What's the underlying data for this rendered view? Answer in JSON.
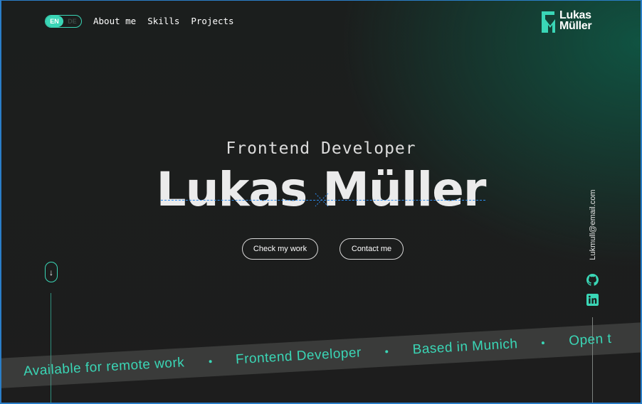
{
  "language_switch": {
    "active": "EN",
    "inactive": "DE"
  },
  "nav": {
    "items": [
      "About me",
      "Skills",
      "Projects"
    ]
  },
  "logo": {
    "line1": "Lukas",
    "line2": "Müller"
  },
  "hero": {
    "subtitle": "Frontend Developer",
    "name": "Lukas Müller",
    "primary_button": "Check my work",
    "secondary_button": "Contact me"
  },
  "scroll_indicator": {
    "glyph": "↓"
  },
  "contact": {
    "email": "Lukmull@email.com"
  },
  "social": [
    "github-icon",
    "linkedin-icon"
  ],
  "marquee": {
    "items": [
      "Available for remote work",
      "Frontend Developer",
      "Based in Munich",
      "Open t"
    ]
  },
  "colors": {
    "accent": "#3ad6b6",
    "background": "#1d1d1d",
    "green_glow": "#0e5c48",
    "guide": "#2b8cf0"
  }
}
